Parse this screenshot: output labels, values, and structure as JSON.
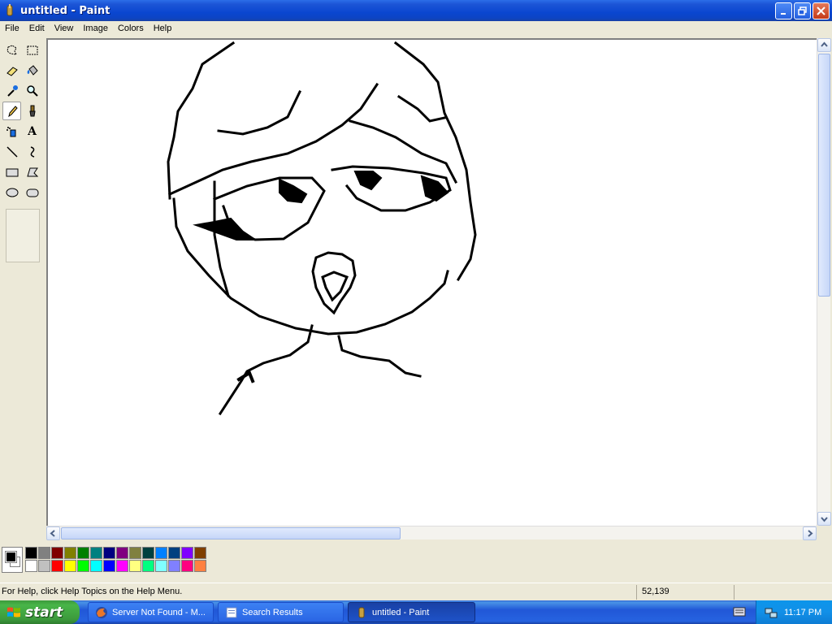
{
  "window": {
    "title": "untitled - Paint"
  },
  "menu": [
    "File",
    "Edit",
    "View",
    "Image",
    "Colors",
    "Help"
  ],
  "tools": [
    {
      "name": "free-form-select-icon"
    },
    {
      "name": "select-icon"
    },
    {
      "name": "eraser-icon"
    },
    {
      "name": "fill-icon"
    },
    {
      "name": "pick-color-icon"
    },
    {
      "name": "magnifier-icon"
    },
    {
      "name": "pencil-icon",
      "active": true
    },
    {
      "name": "brush-icon"
    },
    {
      "name": "airbrush-icon"
    },
    {
      "name": "text-icon",
      "glyph": "A"
    },
    {
      "name": "line-icon"
    },
    {
      "name": "curve-icon"
    },
    {
      "name": "rectangle-icon"
    },
    {
      "name": "polygon-icon"
    },
    {
      "name": "ellipse-icon"
    },
    {
      "name": "rounded-rectangle-icon"
    }
  ],
  "palette": {
    "foreground": "#000000",
    "background": "#ffffff",
    "top_row": [
      "#000000",
      "#808080",
      "#800000",
      "#808000",
      "#008000",
      "#008080",
      "#000080",
      "#800080",
      "#808040",
      "#004040",
      "#0080ff",
      "#004080",
      "#8000ff",
      "#804000"
    ],
    "bottom_row": [
      "#ffffff",
      "#c0c0c0",
      "#ff0000",
      "#ffff00",
      "#00ff00",
      "#00ffff",
      "#0000ff",
      "#ff00ff",
      "#ffff80",
      "#00ff80",
      "#80ffff",
      "#8080ff",
      "#ff0080",
      "#ff8040"
    ]
  },
  "status": {
    "help_text": "For Help, click Help Topics on the Help Menu.",
    "coordinates": "52,139"
  },
  "taskbar": {
    "start_label": "start",
    "tasks": [
      {
        "label": "Server Not Found - M...",
        "icon": "firefox-icon"
      },
      {
        "label": "Search Results",
        "icon": "search-results-icon"
      },
      {
        "label": "untitled - Paint",
        "icon": "paint-icon",
        "active": true
      }
    ],
    "clock": "11:17 PM"
  }
}
